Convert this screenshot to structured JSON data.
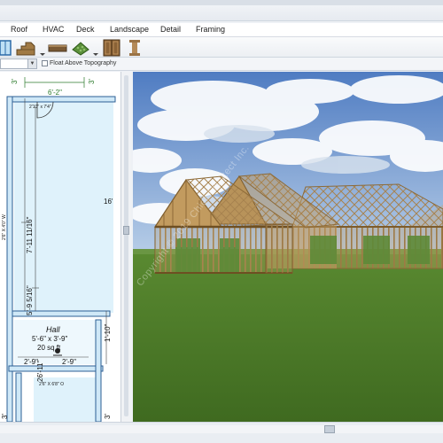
{
  "menu": {
    "items": [
      "Roof",
      "HVAC",
      "Deck",
      "Landscape",
      "Detail",
      "Framing"
    ]
  },
  "toolbar": {
    "icons": [
      "window-tool-icon",
      "stair-tool-icon",
      "bench-tool-icon",
      "plant-tool-icon",
      "cabinet-tool-icon",
      "column-tool-icon"
    ]
  },
  "subbar": {
    "float_label": "Float Above Topography"
  },
  "plan": {
    "dims": {
      "top_dim": "6'-2\"",
      "top_left": "3'",
      "top_right": "3'",
      "door_label": "2'10\" x 7'4\"",
      "v_main": "7'-11 11/16\"",
      "v_mid": "5'-9 5/16\"",
      "v_lower": "26'-11\"",
      "right_dim": "16'",
      "right_lower": "1'-10\"",
      "left_small": "2'6\" X 4'0\" W",
      "hall_name": "Hall",
      "hall_size": "5'-6\" x 3'-9\"",
      "hall_area": "20 sq ft",
      "hall_w1": "2'-9\"",
      "hall_w2": "2'-9\"",
      "bottom_label": "2'6\" X 6'8\" O",
      "bottom_left": "3'",
      "bottom_right": "3'"
    }
  },
  "view3d": {
    "watermark": "Copyright © 2019 Chief Architect Inc."
  },
  "colors": {
    "sky_top": "#5a82c4",
    "sky_bottom": "#a8c3e3",
    "grass": "#4f7a2a",
    "framing": "#b8935a",
    "plan_fill": "#dff2fb",
    "wall": "#3c6fa0"
  }
}
